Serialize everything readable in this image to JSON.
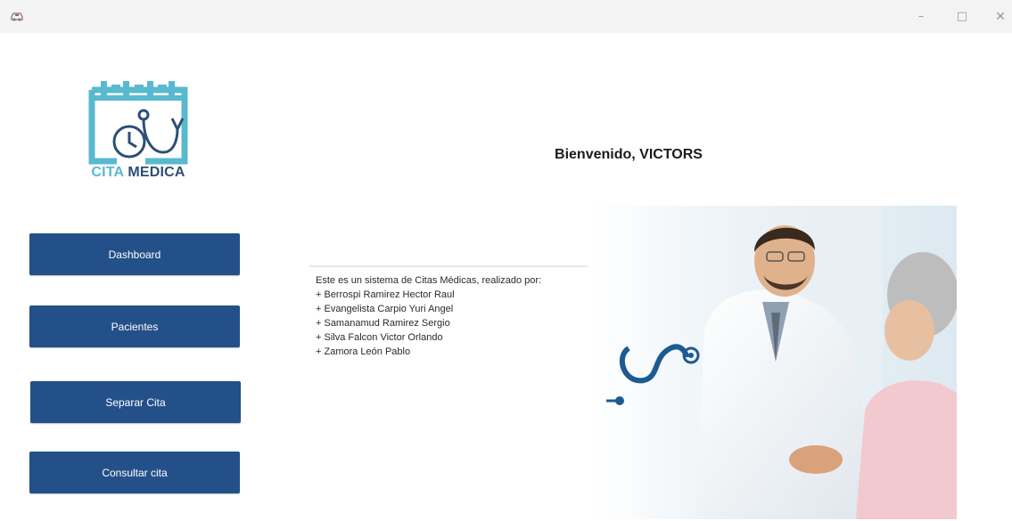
{
  "window": {
    "app_icon": "car-icon",
    "controls": {
      "minimize": "–",
      "maximize": "□",
      "close": "✕"
    }
  },
  "logo": {
    "text_part1": "CITA",
    "text_part2": "MEDICA",
    "icon": "calendar-stethoscope-logo",
    "colors": {
      "light": "#58b9cf",
      "dark": "#2d4f75"
    }
  },
  "welcome": "Bienvenido, VICTORS",
  "nav": {
    "dashboard": "Dashboard",
    "pacientes": "Pacientes",
    "separar_cita": "Separar Cita",
    "consultar_cita": "Consultar cita"
  },
  "info": {
    "intro": "Este es un sistema de Citas Médicas, realizado por:",
    "authors": [
      "+ Berrospi Ramirez Hector Raul",
      "+ Evangelista Carpio Yuri Angel",
      "+ Samanamud Ramirez Sergio",
      "+ Silva Falcon Victor Orlando",
      "+ Zamora León Pablo"
    ]
  },
  "image": {
    "icon": "doctor-patient-photo"
  },
  "colors": {
    "button": "#24508a",
    "titlebar": "#f3f3f3"
  }
}
